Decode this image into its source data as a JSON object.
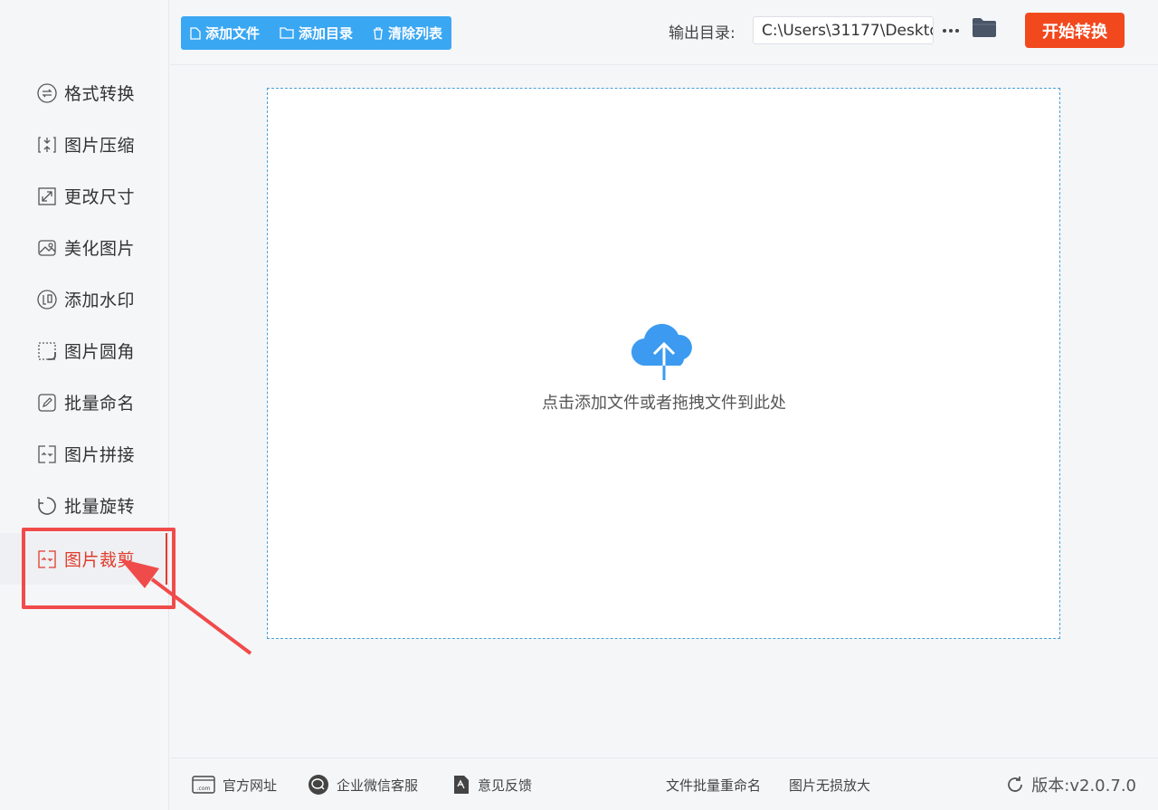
{
  "sidebar": {
    "items": [
      {
        "label": "格式转换",
        "icon": "convert-icon"
      },
      {
        "label": "图片压缩",
        "icon": "compress-icon"
      },
      {
        "label": "更改尺寸",
        "icon": "resize-icon"
      },
      {
        "label": "美化图片",
        "icon": "beautify-icon"
      },
      {
        "label": "添加水印",
        "icon": "watermark-icon"
      },
      {
        "label": "图片圆角",
        "icon": "rounded-corner-icon"
      },
      {
        "label": "批量命名",
        "icon": "rename-icon"
      },
      {
        "label": "图片拼接",
        "icon": "stitch-icon"
      },
      {
        "label": "批量旋转",
        "icon": "rotate-icon"
      },
      {
        "label": "图片裁剪",
        "icon": "crop-icon",
        "active": true
      }
    ]
  },
  "toolbar": {
    "add_file": "添加文件",
    "add_dir": "添加目录",
    "clear_list": "清除列表",
    "output_label": "输出目录:",
    "output_path": "C:\\Users\\31177\\Deskto",
    "more": "···",
    "start": "开始转换"
  },
  "dropzone": {
    "text": "点击添加文件或者拖拽文件到此处"
  },
  "footer": {
    "website": "官方网址",
    "wechat": "企业微信客服",
    "feedback": "意见反馈",
    "batch_rename": "文件批量重命名",
    "enlarge": "图片无损放大",
    "version": "版本:v2.0.7.0"
  },
  "colors": {
    "accent_blue": "#3aa7f3",
    "start_red": "#f2481e",
    "active_red": "#e23b2b",
    "annotation_red": "#f04b4b"
  }
}
